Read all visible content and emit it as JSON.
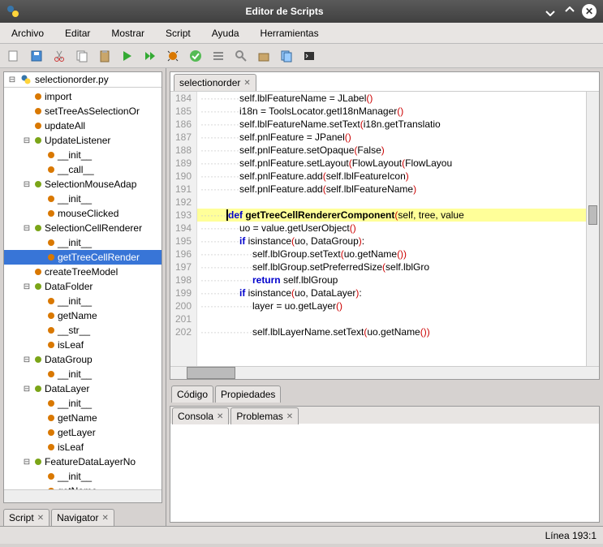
{
  "window": {
    "title": "Editor de Scripts"
  },
  "menu": {
    "items": [
      "Archivo",
      "Editar",
      "Mostrar",
      "Script",
      "Ayuda",
      "Herramientas"
    ]
  },
  "nav": {
    "root": "selectionorder.py",
    "nodes": [
      {
        "depth": 1,
        "exp": "",
        "color": "orange",
        "label": "import"
      },
      {
        "depth": 1,
        "exp": "",
        "color": "orange",
        "label": "setTreeAsSelectionOr"
      },
      {
        "depth": 1,
        "exp": "",
        "color": "orange",
        "label": "updateAll"
      },
      {
        "depth": 1,
        "exp": "−",
        "color": "green",
        "label": "UpdateListener"
      },
      {
        "depth": 2,
        "exp": "",
        "color": "orange",
        "label": "__init__"
      },
      {
        "depth": 2,
        "exp": "",
        "color": "orange",
        "label": "__call__"
      },
      {
        "depth": 1,
        "exp": "−",
        "color": "green",
        "label": "SelectionMouseAdap"
      },
      {
        "depth": 2,
        "exp": "",
        "color": "orange",
        "label": "__init__"
      },
      {
        "depth": 2,
        "exp": "",
        "color": "orange",
        "label": "mouseClicked"
      },
      {
        "depth": 1,
        "exp": "−",
        "color": "green",
        "label": "SelectionCellRenderer"
      },
      {
        "depth": 2,
        "exp": "",
        "color": "orange",
        "label": "__init__"
      },
      {
        "depth": 2,
        "exp": "",
        "color": "orange",
        "label": "getTreeCellRender",
        "selected": true
      },
      {
        "depth": 1,
        "exp": "",
        "color": "orange",
        "label": "createTreeModel"
      },
      {
        "depth": 1,
        "exp": "−",
        "color": "green",
        "label": "DataFolder"
      },
      {
        "depth": 2,
        "exp": "",
        "color": "orange",
        "label": "__init__"
      },
      {
        "depth": 2,
        "exp": "",
        "color": "orange",
        "label": "getName"
      },
      {
        "depth": 2,
        "exp": "",
        "color": "orange",
        "label": "__str__"
      },
      {
        "depth": 2,
        "exp": "",
        "color": "orange",
        "label": "isLeaf"
      },
      {
        "depth": 1,
        "exp": "−",
        "color": "green",
        "label": "DataGroup"
      },
      {
        "depth": 2,
        "exp": "",
        "color": "orange",
        "label": "__init__"
      },
      {
        "depth": 1,
        "exp": "−",
        "color": "green",
        "label": "DataLayer"
      },
      {
        "depth": 2,
        "exp": "",
        "color": "orange",
        "label": "__init__"
      },
      {
        "depth": 2,
        "exp": "",
        "color": "orange",
        "label": "getName"
      },
      {
        "depth": 2,
        "exp": "",
        "color": "orange",
        "label": "getLayer"
      },
      {
        "depth": 2,
        "exp": "",
        "color": "orange",
        "label": "isLeaf"
      },
      {
        "depth": 1,
        "exp": "−",
        "color": "green",
        "label": "FeatureDataLayerNo"
      },
      {
        "depth": 2,
        "exp": "",
        "color": "orange",
        "label": "__init__"
      },
      {
        "depth": 2,
        "exp": "",
        "color": "orange",
        "label": "getName"
      }
    ]
  },
  "left_tabs": [
    {
      "label": "Script",
      "closable": true
    },
    {
      "label": "Navigator",
      "closable": true
    }
  ],
  "editor": {
    "tab_label": "selectionorder",
    "first_line": 184,
    "lines": [
      {
        "n": 184,
        "ind": 3,
        "tokens": [
          [
            "",
            "self.lblFeatureName = JLabel"
          ],
          [
            "par",
            "()"
          ]
        ]
      },
      {
        "n": 185,
        "ind": 3,
        "tokens": [
          [
            "",
            "i18n = ToolsLocator.getI18nManager"
          ],
          [
            "par",
            "()"
          ]
        ]
      },
      {
        "n": 186,
        "ind": 3,
        "tokens": [
          [
            "",
            "self.lblFeatureName.setText"
          ],
          [
            "par",
            "("
          ],
          [
            "",
            "i18n.getTranslatio"
          ]
        ]
      },
      {
        "n": 187,
        "ind": 3,
        "tokens": [
          [
            "",
            "self.pnlFeature = JPanel"
          ],
          [
            "par",
            "()"
          ]
        ]
      },
      {
        "n": 188,
        "ind": 3,
        "tokens": [
          [
            "",
            "self.pnlFeature.setOpaque"
          ],
          [
            "par",
            "("
          ],
          [
            "",
            "False"
          ],
          [
            "par",
            ")"
          ]
        ]
      },
      {
        "n": 189,
        "ind": 3,
        "tokens": [
          [
            "",
            "self.pnlFeature.setLayout"
          ],
          [
            "par",
            "("
          ],
          [
            "",
            "FlowLayout"
          ],
          [
            "par",
            "("
          ],
          [
            "",
            "FlowLayou"
          ]
        ]
      },
      {
        "n": 190,
        "ind": 3,
        "tokens": [
          [
            "",
            "self.pnlFeature.add"
          ],
          [
            "par",
            "("
          ],
          [
            "",
            "self.lblFeatureIcon"
          ],
          [
            "par",
            ")"
          ]
        ]
      },
      {
        "n": 191,
        "ind": 3,
        "tokens": [
          [
            "",
            "self.pnlFeature.add"
          ],
          [
            "par",
            "("
          ],
          [
            "",
            "self.lblFeatureName"
          ],
          [
            "par",
            ")"
          ]
        ]
      },
      {
        "n": 192,
        "ind": 0,
        "tokens": []
      },
      {
        "n": 193,
        "ind": 2,
        "hl": true,
        "cursor": true,
        "tokens": [
          [
            "kw",
            "def "
          ],
          [
            "fn",
            "getTreeCellRendererComponent"
          ],
          [
            "par",
            "("
          ],
          [
            "",
            "self, tree, value"
          ]
        ]
      },
      {
        "n": 194,
        "ind": 3,
        "tokens": [
          [
            "",
            "uo = value.getUserObject"
          ],
          [
            "par",
            "()"
          ]
        ]
      },
      {
        "n": 195,
        "ind": 3,
        "tokens": [
          [
            "kw",
            "if "
          ],
          [
            "",
            "isinstance"
          ],
          [
            "par",
            "("
          ],
          [
            "",
            "uo, DataGroup"
          ],
          [
            "par",
            ")"
          ],
          [
            "",
            ":"
          ]
        ]
      },
      {
        "n": 196,
        "ind": 4,
        "tokens": [
          [
            "",
            "self.lblGroup.setText"
          ],
          [
            "par",
            "("
          ],
          [
            "",
            "uo.getName"
          ],
          [
            "par",
            "())"
          ]
        ]
      },
      {
        "n": 197,
        "ind": 4,
        "tokens": [
          [
            "",
            "self.lblGroup.setPreferredSize"
          ],
          [
            "par",
            "("
          ],
          [
            "",
            "self.lblGro"
          ]
        ]
      },
      {
        "n": 198,
        "ind": 4,
        "tokens": [
          [
            "kw",
            "return "
          ],
          [
            "",
            "self.lblGroup"
          ]
        ]
      },
      {
        "n": 199,
        "ind": 3,
        "tokens": [
          [
            "kw",
            "if "
          ],
          [
            "",
            "isinstance"
          ],
          [
            "par",
            "("
          ],
          [
            "",
            "uo, DataLayer"
          ],
          [
            "par",
            ")"
          ],
          [
            "",
            ":"
          ]
        ]
      },
      {
        "n": 200,
        "ind": 4,
        "tokens": [
          [
            "",
            "layer = uo.getLayer"
          ],
          [
            "par",
            "()"
          ]
        ]
      },
      {
        "n": 201,
        "ind": 0,
        "tokens": []
      },
      {
        "n": 202,
        "ind": 4,
        "tokens": [
          [
            "",
            "self.lblLayerName.setText"
          ],
          [
            "par",
            "("
          ],
          [
            "",
            "uo.getName"
          ],
          [
            "par",
            "())"
          ]
        ]
      }
    ]
  },
  "mid_tabs": [
    {
      "label": "Código"
    },
    {
      "label": "Propiedades"
    }
  ],
  "console_tabs": [
    {
      "label": "Consola",
      "closable": true
    },
    {
      "label": "Problemas",
      "closable": true
    }
  ],
  "status": {
    "pos": "Línea 193:1"
  }
}
